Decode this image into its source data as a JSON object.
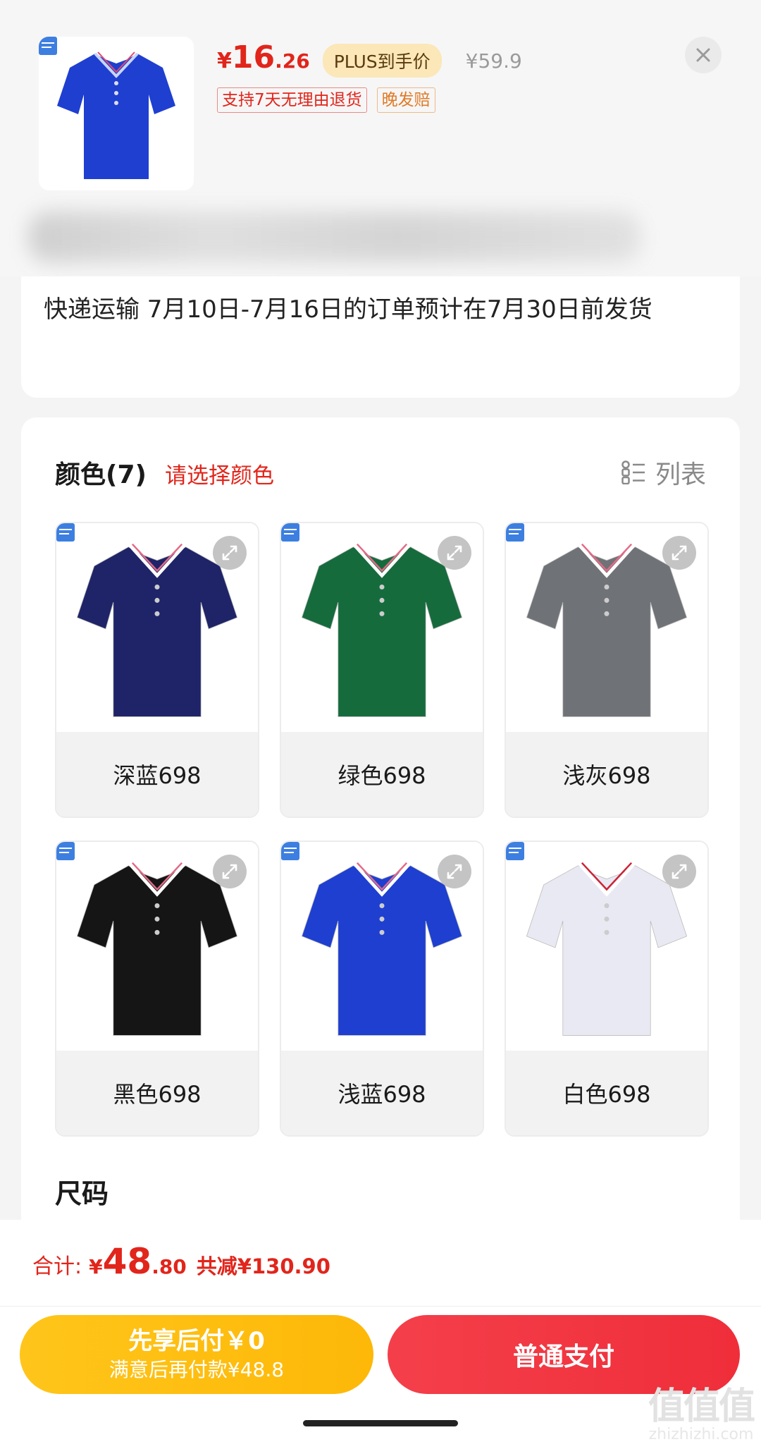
{
  "product": {
    "price_symbol": "¥",
    "price_int": "16",
    "price_dec": ".26",
    "plus_label": "PLUS到手价",
    "original_price": "¥59.9",
    "tags": [
      "支持7天无理由退货",
      "晚发赔"
    ],
    "shirt_color": "#1e3fd0"
  },
  "shipping": {
    "text": "快递运输 7月10日-7月16日的订单预计在7月30日前发货"
  },
  "colors": {
    "title": "颜色(7)",
    "hint": "请选择颜色",
    "list_label": "列表",
    "items": [
      {
        "label": "深蓝698",
        "hex": "#1f2468"
      },
      {
        "label": "绿色698",
        "hex": "#166b3d"
      },
      {
        "label": "浅灰698",
        "hex": "#6f7276"
      },
      {
        "label": "黑色698",
        "hex": "#151515"
      },
      {
        "label": "浅蓝698",
        "hex": "#1e3fd0"
      },
      {
        "label": "白色698",
        "hex": "#e9e9f3"
      }
    ]
  },
  "size": {
    "title": "尺码"
  },
  "footer": {
    "total_label": "合计:",
    "total_symbol": "¥",
    "total_int": "48",
    "total_dec": ".80",
    "total_saving": "共减¥130.90",
    "later_line1": "先享后付￥0",
    "later_line2": "满意后再付款¥48.8",
    "pay_label": "普通支付"
  },
  "watermark": {
    "line1": "值值值",
    "line2": "zhizhizhi.com"
  },
  "accent": "#e1251b"
}
